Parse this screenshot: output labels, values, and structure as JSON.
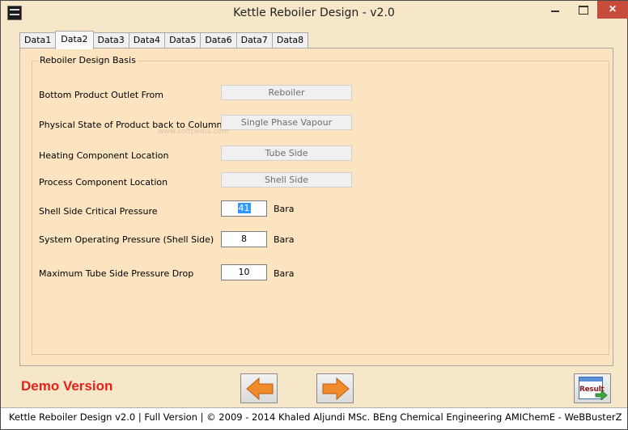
{
  "window": {
    "title": "Kettle Reboiler Design - v2.0",
    "close_glyph": "✕"
  },
  "tabs": [
    {
      "label": "Data1",
      "active": false
    },
    {
      "label": "Data2",
      "active": true
    },
    {
      "label": "Data3",
      "active": false
    },
    {
      "label": "Data4",
      "active": false
    },
    {
      "label": "Data5",
      "active": false
    },
    {
      "label": "Data6",
      "active": false
    },
    {
      "label": "Data7",
      "active": false
    },
    {
      "label": "Data8",
      "active": false
    }
  ],
  "group": {
    "title": "Reboiler Design Basis",
    "watermark": "www.softpedia.com"
  },
  "fields": {
    "bottom_product_outlet": {
      "label": "Bottom Product Outlet From",
      "value": "Reboiler"
    },
    "physical_state": {
      "label": "Physical State of Product back to Column",
      "value": "Single Phase Vapour"
    },
    "heating_location": {
      "label": "Heating Component Location",
      "value": "Tube Side"
    },
    "process_location": {
      "label": "Process Component Location",
      "value": "Shell Side"
    },
    "critical_pressure": {
      "label": "Shell Side Critical Pressure",
      "value": "41",
      "unit": "Bara"
    },
    "operating_pressure": {
      "label": "System Operating Pressure (Shell Side)",
      "value": "8",
      "unit": "Bara"
    },
    "tube_pressure_drop": {
      "label": "Maximum Tube Side Pressure Drop",
      "value": "10",
      "unit": "Bara"
    }
  },
  "footer": {
    "demo_label": "Demo Version",
    "result_label": "Result"
  },
  "colors": {
    "panel_bg": "#fde4c1",
    "demo_red": "#e8201d",
    "arrow_orange": "#f08a2a"
  },
  "statusbar": {
    "text": "Kettle Reboiler Design  v2.0  |  Full Version  |  © 2009 - 2014 Khaled Aljundi MSc. BEng Chemical Engineering AMIChemE - WeBBusterZ"
  }
}
